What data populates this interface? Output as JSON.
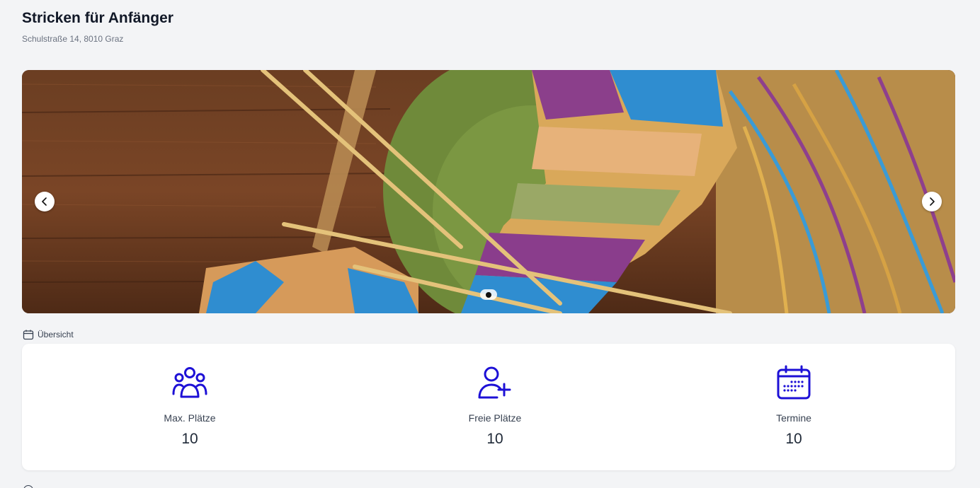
{
  "header": {
    "title": "Stricken für Anfänger",
    "address": "Schulstraße 14, 8010 Graz"
  },
  "carousel": {
    "image_icon": "knitting-photo",
    "prev_icon": "chevron-left-icon",
    "next_icon": "chevron-right-icon",
    "slide_count": 1,
    "active_slide": 1
  },
  "overview": {
    "label": "Übersicht",
    "icon": "calendar-icon",
    "accent_color": "#1d10d6",
    "stats": [
      {
        "icon": "users-group-icon",
        "label": "Max. Plätze",
        "value": "10"
      },
      {
        "icon": "user-plus-icon",
        "label": "Freie Plätze",
        "value": "10"
      },
      {
        "icon": "calendar-dates-icon",
        "label": "Termine",
        "value": "10"
      }
    ]
  }
}
